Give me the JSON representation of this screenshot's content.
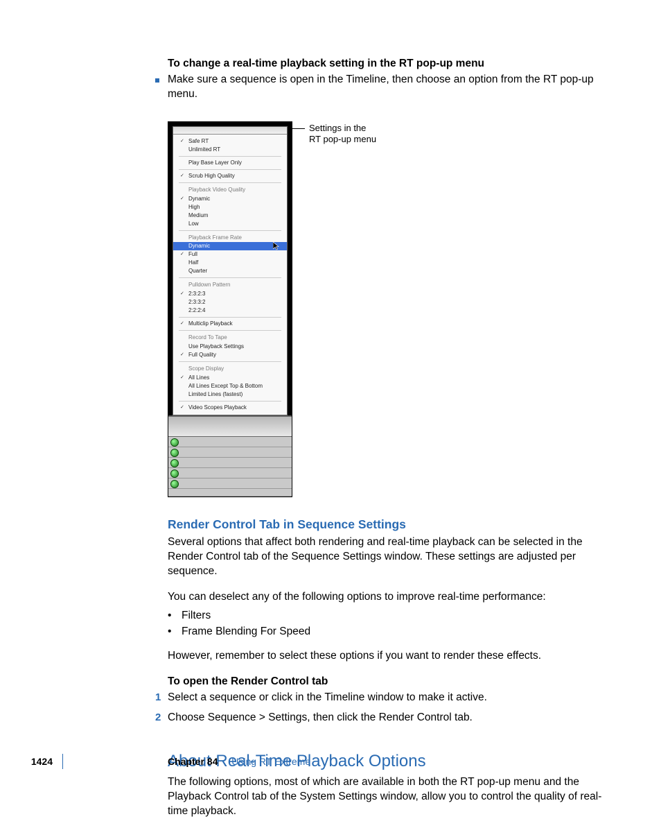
{
  "intro": {
    "heading": "To change a real-time playback setting in the RT pop-up menu",
    "bullet_text": "Make sure a sequence is open in the Timeline, then choose an option from the RT pop-up menu."
  },
  "callout": {
    "line1": "Settings in the",
    "line2": "RT pop-up menu"
  },
  "menu": {
    "safe_rt": "Safe RT",
    "unlimited_rt": "Unlimited RT",
    "play_base": "Play Base Layer Only",
    "scrub_hq": "Scrub High Quality",
    "grp_video": "Playback Video Quality",
    "dynamic": "Dynamic",
    "high": "High",
    "medium": "Medium",
    "low": "Low",
    "grp_rate": "Playback Frame Rate",
    "full": "Full",
    "half": "Half",
    "quarter": "Quarter",
    "grp_pulldown": "Pulldown Pattern",
    "p2323": "2:3:2:3",
    "p2332": "2:3:3:2",
    "p2224": "2:2:2:4",
    "multiclip": "Multiclip Playback",
    "grp_record": "Record To Tape",
    "use_pb": "Use Playback Settings",
    "full_quality": "Full Quality",
    "grp_scope": "Scope Display",
    "all_lines": "All Lines",
    "except": "All Lines Except Top & Bottom",
    "limited": "Limited Lines (fastest)",
    "scopes_pb": "Video Scopes Playback"
  },
  "render_section": {
    "heading": "Render Control Tab in Sequence Settings",
    "p1": "Several options that affect both rendering and real-time playback can be selected in the Render Control tab of the Sequence Settings window. These settings are adjusted per sequence.",
    "p2": "You can deselect any of the following options to improve real-time performance:",
    "li1": "Filters",
    "li2": "Frame Blending For Speed",
    "p3": "However, remember to select these options if you want to render these effects.",
    "sub_heading": "To open the Render Control tab",
    "step1": "Select a sequence or click in the Timeline window to make it active.",
    "step2": "Choose Sequence > Settings, then click the Render Control tab."
  },
  "about_section": {
    "heading": "About Real-Time Playback Options",
    "p1": "The following options, most of which are available in both the RT pop-up menu and the Playback Control tab of the System Settings window, allow you to control the quality of real-time playback."
  },
  "footer": {
    "page": "1424",
    "chapter": "Chapter 84",
    "title": "Using RT Extreme"
  }
}
